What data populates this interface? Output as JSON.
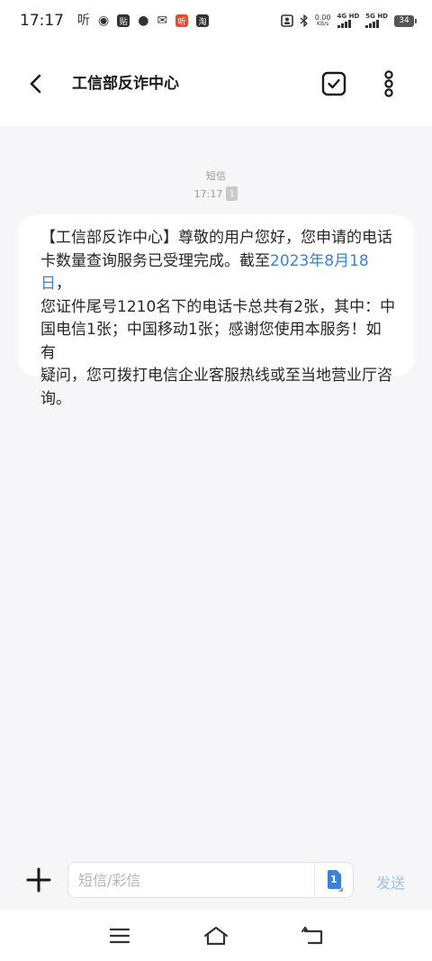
{
  "status_bar": {
    "time": "17:17",
    "left_icons": [
      {
        "name": "listen-app-icon",
        "glyph": "听"
      },
      {
        "name": "location-icon",
        "glyph": "◉"
      },
      {
        "name": "sticker-app-icon",
        "glyph": "贴"
      },
      {
        "name": "chat-bubble-icon",
        "glyph": "●"
      },
      {
        "name": "mail-icon",
        "glyph": "✉"
      },
      {
        "name": "listen-red-app-icon",
        "glyph": "听"
      },
      {
        "name": "taobao-app-icon",
        "glyph": "淘"
      }
    ],
    "net_speed_value": "0.00",
    "net_speed_unit": "KB/s",
    "sim1_label": "4G HD",
    "sim2_label": "5G HD",
    "battery": "34"
  },
  "header": {
    "title": "工信部反诈中心"
  },
  "conversation": {
    "meta_label": "短信",
    "meta_time": "17:17",
    "sim_badge": "1",
    "message_lines": [
      "【工信部反诈中心】尊敬的用户您好，您申请的电话",
      "卡数量查询服务已受理完成。截至",
      "，",
      "您证件尾号1210名下的电话卡总共有2张，其中：中",
      "国电信1张；中国移动1张；感谢您使用本服务！如有",
      "疑问，您可拨打电信企业客服热线或至当地营业厅咨",
      "询。"
    ],
    "message_date": "2023年8月18日"
  },
  "composer": {
    "placeholder": "短信/彩信",
    "sim_select_label": "1",
    "send_label": "发送"
  },
  "colors": {
    "background": "#f6f6f8",
    "bubble": "#ffffff",
    "date_link": "#3b82d6",
    "send_disabled": "#9cc3ee",
    "sim_blue": "#3b82d6"
  }
}
